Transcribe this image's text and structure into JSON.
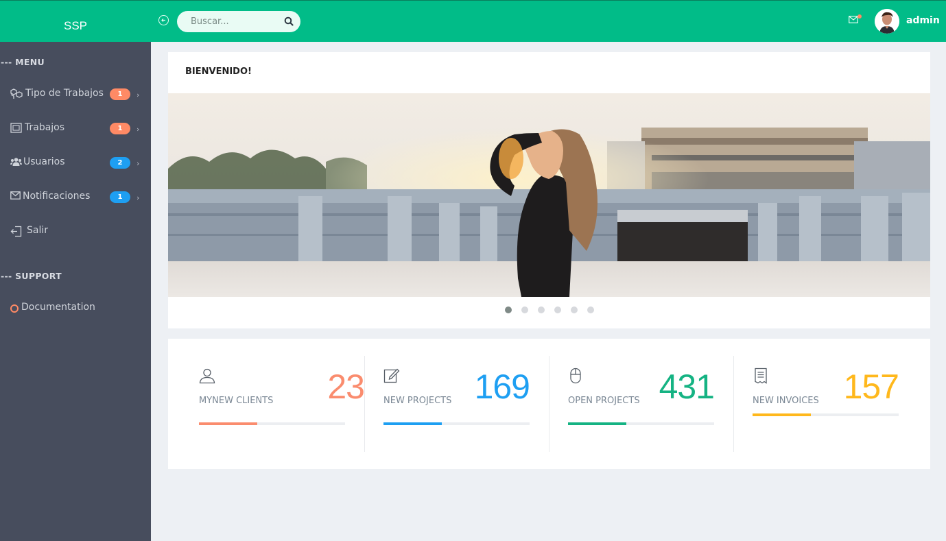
{
  "topbar": {
    "brand": "SSP",
    "search_placeholder": "Buscar...",
    "username": "admin"
  },
  "sidebar": {
    "menu_title": "--- MENU",
    "items": [
      {
        "label": "Tipo de Trabajos",
        "badge": "1",
        "badge_color": "#ff8a65"
      },
      {
        "label": "Trabajos",
        "badge": "1",
        "badge_color": "#ff8a65"
      },
      {
        "label": "Usuarios",
        "badge": "2",
        "badge_color": "#1e9ff2"
      },
      {
        "label": "Notificaciones",
        "badge": "1",
        "badge_color": "#1e9ff2"
      },
      {
        "label": "Salir"
      }
    ],
    "support_title": "--- SUPPORT",
    "support_items": [
      {
        "label": "Documentation"
      }
    ]
  },
  "welcome": {
    "title": "BIENVENIDO!",
    "slides": 6,
    "active_slide": 0
  },
  "stats": [
    {
      "label": "MYNEW CLIENTS",
      "value": "23",
      "color": "#fa8c6e",
      "progress": 0.4,
      "icon": "user-icon"
    },
    {
      "label": "NEW PROJECTS",
      "value": "169",
      "color": "#1e9ff2",
      "progress": 0.4,
      "icon": "edit-icon"
    },
    {
      "label": "OPEN PROJECTS",
      "value": "431",
      "color": "#15b383",
      "progress": 0.4,
      "icon": "mouse-icon"
    },
    {
      "label": "NEW INVOICES",
      "value": "157",
      "color": "#ffb81c",
      "progress": 0.4,
      "icon": "invoice-icon"
    }
  ]
}
